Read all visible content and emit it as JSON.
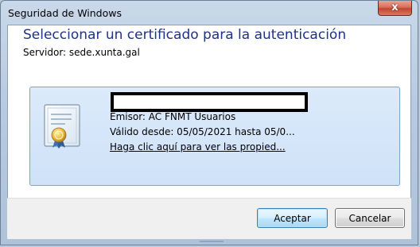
{
  "window": {
    "title": "Seguridad de Windows",
    "close_label": "x"
  },
  "dialog": {
    "heading": "Seleccionar un certificado para la autenticación",
    "server_line": "Servidor: sede.xunta.gal"
  },
  "certificate": {
    "icon": "certificate-icon",
    "issuer": "Emisor: AC FNMT Usuarios",
    "valid_from": "Válido desde: 05/05/2021 hasta 05/0...",
    "properties_link": "Haga clic aquí para ver las propied..."
  },
  "buttons": {
    "accept": "Aceptar",
    "cancel": "Cancelar"
  },
  "colors": {
    "heading": "#1e3287",
    "tile_border": "#7da2ce",
    "close_red": "#c24530"
  }
}
